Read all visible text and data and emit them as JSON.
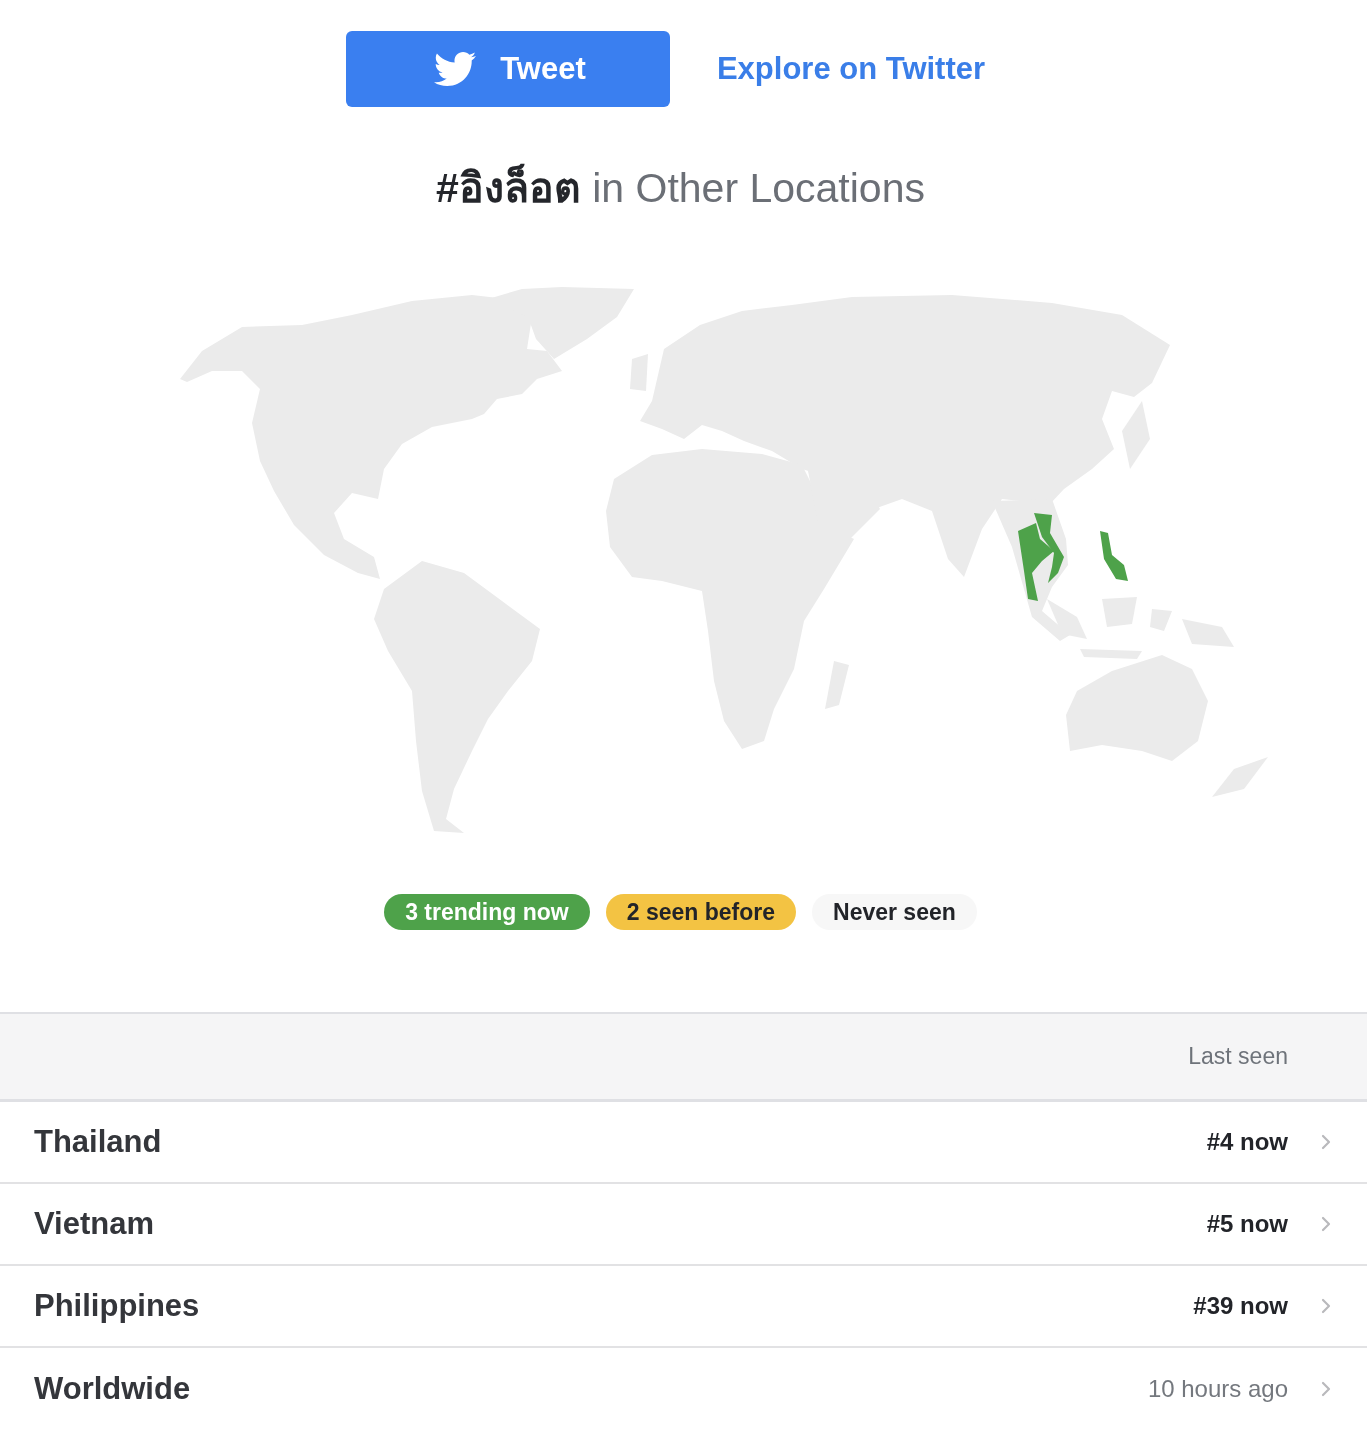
{
  "actions": {
    "tweet_button": "Tweet",
    "explore_link": "Explore on Twitter"
  },
  "heading": {
    "hashtag": "#อิงล็อต",
    "suffix": "in Other Locations"
  },
  "legend": [
    {
      "kind": "trending",
      "label": "3 trending now",
      "color": "#4ea24a"
    },
    {
      "kind": "seen",
      "label": "2 seen before",
      "color": "#f3c343"
    },
    {
      "kind": "never",
      "label": "Never seen",
      "color": "#f7f7f7"
    }
  ],
  "table": {
    "header": {
      "last_seen": "Last seen"
    },
    "rows": [
      {
        "location": "Thailand",
        "last_seen": "#4 now",
        "current": true
      },
      {
        "location": "Vietnam",
        "last_seen": "#5 now",
        "current": true
      },
      {
        "location": "Philippines",
        "last_seen": "#39 now",
        "current": true
      },
      {
        "location": "Worldwide",
        "last_seen": "10 hours ago",
        "current": false
      }
    ]
  }
}
